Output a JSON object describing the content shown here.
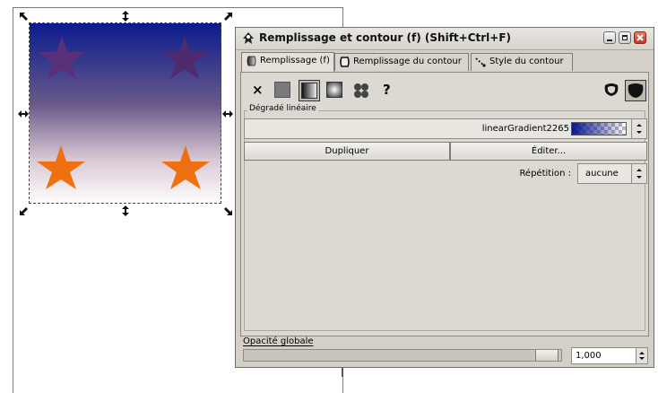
{
  "dialog": {
    "title": "Remplissage et contour (f) (Shift+Ctrl+F)",
    "tabs": [
      {
        "label": "Remplissage (f)",
        "icon": "fill-tab-icon"
      },
      {
        "label": "Remplissage du contour",
        "icon": "stroke-paint-tab-icon"
      },
      {
        "label": "Style du contour",
        "icon": "stroke-style-tab-icon"
      }
    ],
    "fill_buttons": [
      {
        "icon": "no-paint-icon",
        "glyph": "×"
      },
      {
        "icon": "flat-color-icon"
      },
      {
        "icon": "linear-gradient-icon"
      },
      {
        "icon": "radial-gradient-icon"
      },
      {
        "icon": "pattern-icon"
      },
      {
        "icon": "unset-paint-icon",
        "glyph": "?"
      }
    ],
    "fill_rule_icons": [
      "fill-rule-evenodd-icon",
      "fill-rule-nonzero-icon"
    ],
    "section_label": "Dégradé linéaire",
    "gradient_name": "linearGradient2265",
    "duplicate_label": "Dupliquer",
    "edit_label": "Éditer...",
    "repeat_label": "Répétition :",
    "repeat_value": "aucune",
    "opacity_label": "Opacité globale",
    "opacity_value": "1,000",
    "opacity_fraction": 1.0
  },
  "colors": {
    "gradient_top": "#0a1a8c",
    "gradient_bottom": "#ffffff",
    "star_top": "#5a2a78",
    "star_bottom": "#f07010"
  }
}
